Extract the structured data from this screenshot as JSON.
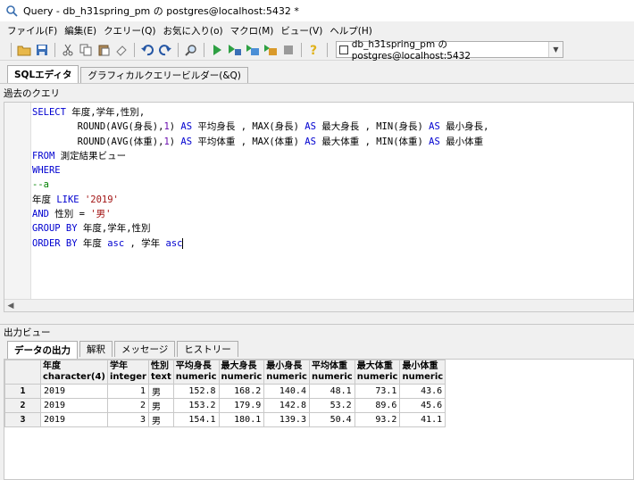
{
  "window": {
    "title": "Query - db_h31spring_pm の postgres@localhost:5432 *"
  },
  "menu": [
    "ファイル(F)",
    "編集(E)",
    "クエリー(Q)",
    "お気に入り(o)",
    "マクロ(M)",
    "ビュー(V)",
    "ヘルプ(H)"
  ],
  "toolbar": {
    "connection": "db_h31spring_pm の postgres@localhost:5432"
  },
  "editor_tabs": [
    "SQLエディタ",
    "グラフィカルクエリービルダー(&Q)"
  ],
  "history_label": "過去のクエリ",
  "query_lines": [
    [
      [
        "SELECT",
        "kw"
      ],
      [
        " 年度,学年,性別,",
        ""
      ]
    ],
    [
      [
        "        ROUND(AVG(身長),",
        ""
      ],
      [
        "1",
        "num"
      ],
      [
        ") ",
        ""
      ],
      [
        "AS",
        "kw"
      ],
      [
        " 平均身長 , MAX(身長) ",
        ""
      ],
      [
        "AS",
        "kw"
      ],
      [
        " 最大身長 , MIN(身長) ",
        ""
      ],
      [
        "AS",
        "kw"
      ],
      [
        " 最小身長,",
        ""
      ]
    ],
    [
      [
        "        ROUND(AVG(体重),",
        ""
      ],
      [
        "1",
        "num"
      ],
      [
        ") ",
        ""
      ],
      [
        "AS",
        "kw"
      ],
      [
        " 平均体重 , MAX(体重) ",
        ""
      ],
      [
        "AS",
        "kw"
      ],
      [
        " 最大体重 , MIN(体重) ",
        ""
      ],
      [
        "AS",
        "kw"
      ],
      [
        " 最小体重",
        ""
      ]
    ],
    [
      [
        "FROM",
        "kw"
      ],
      [
        " 測定結果ビュー",
        ""
      ]
    ],
    [
      [
        "WHERE",
        "kw"
      ]
    ],
    [
      [
        "--a",
        "cmt"
      ]
    ],
    [
      [
        "年度 ",
        ""
      ],
      [
        "LIKE",
        "kw"
      ],
      [
        " ",
        ""
      ],
      [
        "'2019'",
        "str"
      ]
    ],
    [
      [
        "AND",
        "kw"
      ],
      [
        " 性別 = ",
        ""
      ],
      [
        "'男'",
        "str"
      ]
    ],
    [
      [
        "GROUP BY",
        "kw"
      ],
      [
        " 年度,学年,性別",
        ""
      ]
    ],
    [
      [
        "ORDER BY",
        "kw"
      ],
      [
        " 年度 ",
        ""
      ],
      [
        "asc",
        "kw"
      ],
      [
        " , 学年 ",
        ""
      ],
      [
        "asc",
        "kw"
      ]
    ]
  ],
  "output_label": "出力ビュー",
  "output_tabs": [
    "データの出力",
    "解釈",
    "メッセージ",
    "ヒストリー"
  ],
  "result": {
    "columns": [
      {
        "name": "年度",
        "type": "character(4)"
      },
      {
        "name": "学年",
        "type": "integer"
      },
      {
        "name": "性別",
        "type": "text"
      },
      {
        "name": "平均身長",
        "type": "numeric"
      },
      {
        "name": "最大身長",
        "type": "numeric"
      },
      {
        "name": "最小身長",
        "type": "numeric"
      },
      {
        "name": "平均体重",
        "type": "numeric"
      },
      {
        "name": "最大体重",
        "type": "numeric"
      },
      {
        "name": "最小体重",
        "type": "numeric"
      }
    ],
    "rows": [
      [
        "2019",
        "1",
        "男",
        "152.8",
        "168.2",
        "140.4",
        "48.1",
        "73.1",
        "43.6"
      ],
      [
        "2019",
        "2",
        "男",
        "153.2",
        "179.9",
        "142.8",
        "53.2",
        "89.6",
        "45.6"
      ],
      [
        "2019",
        "3",
        "男",
        "154.1",
        "180.1",
        "139.3",
        "50.4",
        "93.2",
        "41.1"
      ]
    ],
    "row_numbers": [
      "1",
      "2",
      "3"
    ]
  }
}
